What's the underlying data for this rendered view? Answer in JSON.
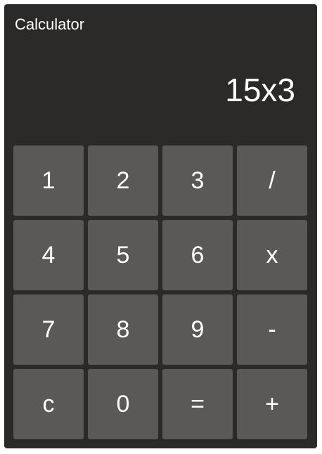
{
  "calculator": {
    "title": "Calculator",
    "display": "15x3"
  },
  "keys": {
    "k1": "1",
    "k2": "2",
    "k3": "3",
    "divide": "/",
    "k4": "4",
    "k5": "5",
    "k6": "6",
    "multiply": "x",
    "k7": "7",
    "k8": "8",
    "k9": "9",
    "subtract": "-",
    "clear": "c",
    "k0": "0",
    "equals": "=",
    "add": "+"
  },
  "colors": {
    "panel": "#2b2a28",
    "key": "#5b5958",
    "text": "#ffffff"
  }
}
